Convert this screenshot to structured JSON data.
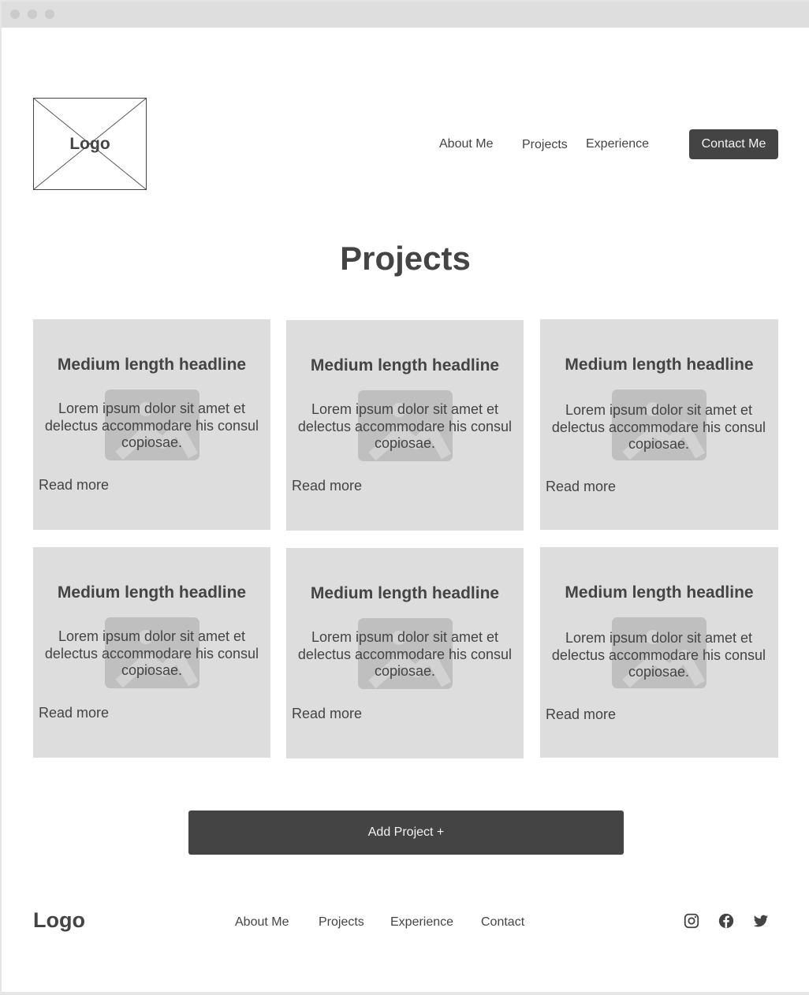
{
  "window": {
    "controls": [
      "close",
      "minimize",
      "maximize"
    ]
  },
  "header": {
    "logo_label": "Logo",
    "nav": [
      {
        "label": "About Me"
      },
      {
        "label": "Projects"
      },
      {
        "label": "Experience"
      }
    ],
    "contact_button": "Contact Me"
  },
  "main": {
    "title": "Projects",
    "cards": [
      {
        "headline": "Medium length headline",
        "body": "Lorem ipsum dolor sit amet et delectus accommodare his consul copiosae.",
        "link": "Read more",
        "image": "image-placeholder-icon"
      },
      {
        "headline": "Medium length headline",
        "body": "Lorem ipsum dolor sit amet et delectus accommodare his consul copiosae.",
        "link": "Read more",
        "image": "image-placeholder-icon"
      },
      {
        "headline": "Medium length headline",
        "body": "Lorem ipsum dolor sit amet et delectus accommodare his consul copiosae.",
        "link": "Read more",
        "image": "image-placeholder-icon"
      },
      {
        "headline": "Medium length headline",
        "body": "Lorem ipsum dolor sit amet et delectus accommodare his consul copiosae.",
        "link": "Read more",
        "image": "image-placeholder-icon"
      },
      {
        "headline": "Medium length headline",
        "body": "Lorem ipsum dolor sit amet et delectus accommodare his consul copiosae.",
        "link": "Read more",
        "image": "image-placeholder-icon"
      },
      {
        "headline": "Medium length headline",
        "body": "Lorem ipsum dolor sit amet et delectus accommodare his consul copiosae.",
        "link": "Read more",
        "image": "image-placeholder-icon"
      }
    ],
    "add_button": "Add Project +"
  },
  "footer": {
    "logo": "Logo",
    "links": [
      {
        "label": "About Me"
      },
      {
        "label": "Projects"
      },
      {
        "label": "Experience"
      },
      {
        "label": "Contact"
      }
    ],
    "social": [
      "instagram-icon",
      "facebook-icon",
      "twitter-icon"
    ]
  },
  "colors": {
    "primary_dark": "#444444",
    "card_bg": "#dddddd",
    "placeholder": "#bfbfbf",
    "titlebar": "#dedede"
  }
}
